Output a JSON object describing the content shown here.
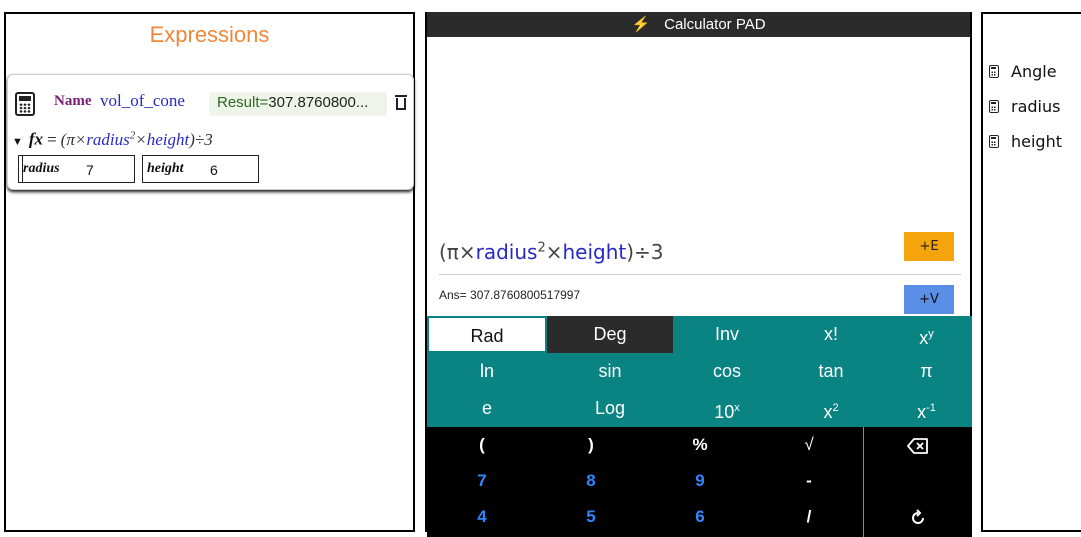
{
  "expressions": {
    "title": "Expressions",
    "card": {
      "name_label": "Name",
      "name_value": "vol_of_cone",
      "result_label": "Result=",
      "result_value": "307.8760800...",
      "formula": {
        "fx": "fx",
        "eq": "=",
        "open": "(π×",
        "var1": "radius",
        "exp": "2",
        "times": "×",
        "var2": "height",
        "close": ")÷3"
      },
      "variables": [
        {
          "name": "radius",
          "value": "7"
        },
        {
          "name": "height",
          "value": "6"
        }
      ]
    }
  },
  "calculator": {
    "title": "Calculator PAD",
    "display": {
      "open": "(π×",
      "var1": "radius",
      "exp": "2",
      "times": "×",
      "var2": "height",
      "close": ")÷3",
      "ans": "Ans= 307.8760800517997",
      "add_expression": "+E",
      "add_variable": "+V"
    },
    "sci_keys": {
      "row1": [
        "Rad",
        "Deg",
        "Inv",
        "x!",
        "x"
      ],
      "row1_sup": "y",
      "row2": [
        "ln",
        "sin",
        "cos",
        "tan",
        "π"
      ],
      "row3": [
        "e",
        "Log",
        "10",
        "x",
        "x"
      ],
      "row3_sup": [
        "x",
        "2",
        "-1"
      ]
    },
    "num_keys": {
      "row1": [
        "(",
        ")",
        "%",
        "√"
      ],
      "row2": [
        "7",
        "8",
        "9",
        "-"
      ],
      "row3": [
        "4",
        "5",
        "6",
        "/"
      ]
    },
    "colors": {
      "teal": "#0a8383",
      "orange": "#f5a40b",
      "blue": "#5b8ee6",
      "digit_blue": "#2f86ff"
    }
  },
  "variables_panel": {
    "items": [
      "Angle",
      "radius",
      "height"
    ]
  },
  "icons": [
    "calculator-icon",
    "trash-icon",
    "caret-down-icon",
    "bolt-icon",
    "backspace-icon",
    "refresh-icon"
  ]
}
